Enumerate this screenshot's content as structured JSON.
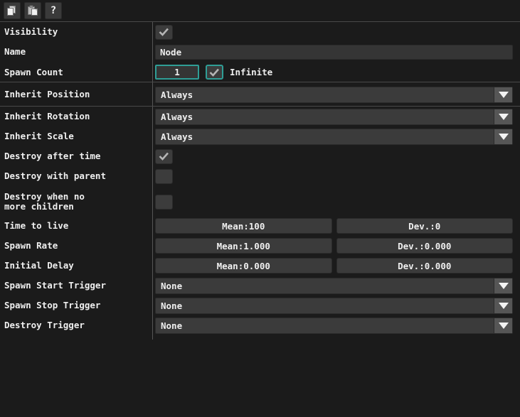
{
  "toolbar": {
    "buttons": [
      {
        "name": "copy-button",
        "icon": "copy-icon",
        "tooltip": "Copy"
      },
      {
        "name": "paste-button",
        "icon": "paste-icon",
        "tooltip": "Paste"
      },
      {
        "name": "help-button",
        "icon": "question-mark-icon",
        "glyph": "?",
        "tooltip": "Help"
      }
    ]
  },
  "colors": {
    "window_background": "#1b1b1b",
    "field_background": "#353535",
    "control_background": "#3b3b3b",
    "focus_accent": "#2f9e96",
    "separator": "#4a4a4a",
    "text": "#efefef",
    "arrow_button": "#565656"
  },
  "properties": {
    "visibility": {
      "label": "Visibility",
      "checked": true
    },
    "name": {
      "label": "Name",
      "value": "Node",
      "placeholder": "Name"
    },
    "spawn_count": {
      "label": "Spawn Count",
      "value": "1",
      "infinite_label": "Infinite",
      "infinite_checked": true
    },
    "inherit_position": {
      "label": "Inherit Position",
      "value": "Always"
    },
    "inherit_rotation": {
      "label": "Inherit Rotation",
      "value": "Always"
    },
    "inherit_scale": {
      "label": "Inherit Scale",
      "value": "Always"
    },
    "destroy_after_time": {
      "label": "Destroy after time",
      "checked": true
    },
    "destroy_with_parent": {
      "label": "Destroy with parent",
      "checked": false
    },
    "destroy_when_no_more_children": {
      "label_line1": "Destroy when no",
      "label_line2": "more children",
      "checked": false
    },
    "time_to_live": {
      "label": "Time to live",
      "mean": "Mean:100",
      "dev": "Dev.:0"
    },
    "spawn_rate": {
      "label": "Spawn Rate",
      "mean": "Mean:1.000",
      "dev": "Dev.:0.000"
    },
    "initial_delay": {
      "label": "Initial Delay",
      "mean": "Mean:0.000",
      "dev": "Dev.:0.000"
    },
    "spawn_start_trigger": {
      "label": "Spawn Start Trigger",
      "value": "None"
    },
    "spawn_stop_trigger": {
      "label": "Spawn Stop Trigger",
      "value": "None"
    },
    "destroy_trigger": {
      "label": "Destroy Trigger",
      "value": "None"
    }
  }
}
